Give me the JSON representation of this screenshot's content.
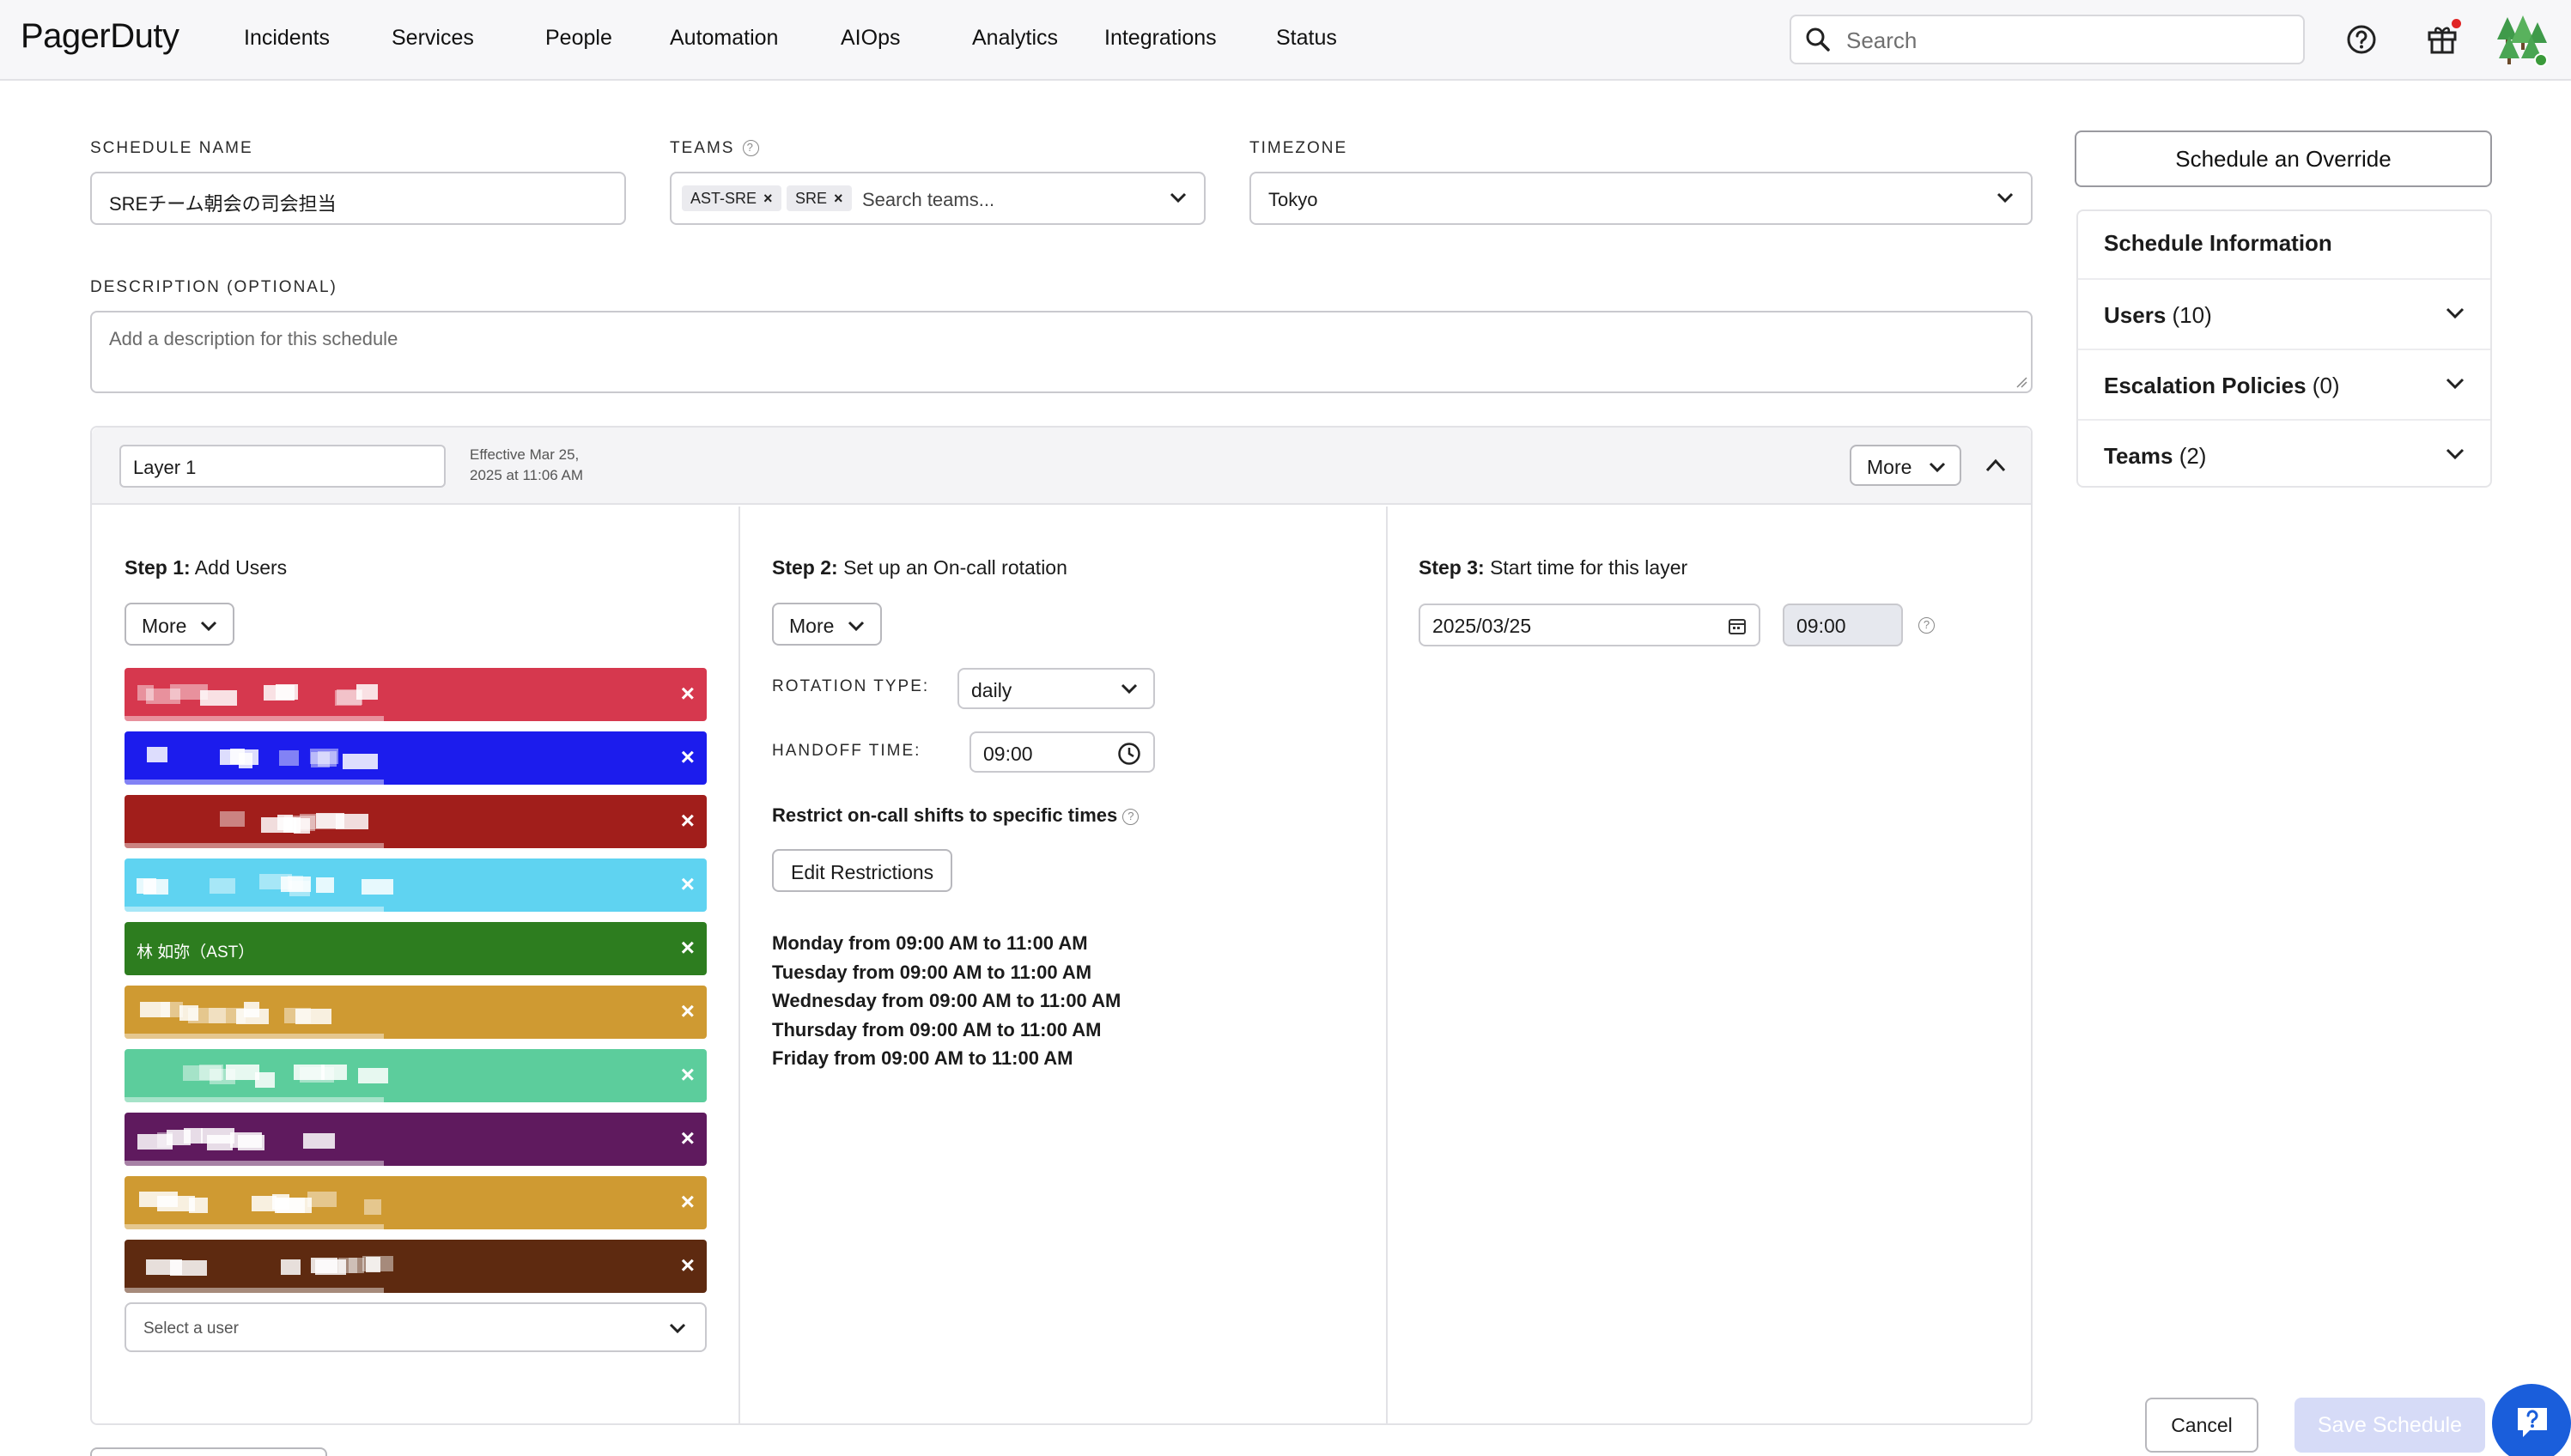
{
  "nav": {
    "logo": "PagerDuty",
    "items": [
      "Incidents",
      "Services",
      "People",
      "Automation",
      "AIOps",
      "Analytics",
      "Integrations",
      "Status"
    ],
    "search_placeholder": "Search"
  },
  "form": {
    "schedule_name_label": "SCHEDULE NAME",
    "schedule_name_value": "SREチーム朝会の司会担当",
    "teams_label": "TEAMS",
    "teams_chips": [
      "AST-SRE",
      "SRE"
    ],
    "teams_placeholder": "Search teams...",
    "timezone_label": "TIMEZONE",
    "timezone_value": "Tokyo",
    "description_label": "DESCRIPTION (OPTIONAL)",
    "description_placeholder": "Add a description for this schedule"
  },
  "layer": {
    "name": "Layer 1",
    "effective_line1": "Effective Mar 25,",
    "effective_line2": "2025 at 11:06 AM",
    "more_label": "More",
    "step1_bold": "Step 1:",
    "step1_text": " Add Users",
    "step1_more": "More",
    "users": [
      {
        "color": "#d6384e",
        "name": ""
      },
      {
        "color": "#1c1ced",
        "name": ""
      },
      {
        "color": "#a11e1b",
        "name": ""
      },
      {
        "color": "#5fd3f1",
        "name": ""
      },
      {
        "color": "#2d7d1f",
        "name": "林 如弥（AST）"
      },
      {
        "color": "#cf9a32",
        "name": ""
      },
      {
        "color": "#5ccd9c",
        "name": ""
      },
      {
        "color": "#5f1a5e",
        "name": ""
      },
      {
        "color": "#cf9a32",
        "name": ""
      },
      {
        "color": "#5e2a10",
        "name": ""
      }
    ],
    "select_user_placeholder": "Select a user",
    "step2_bold": "Step 2:",
    "step2_text": " Set up an On-call rotation",
    "step2_more": "More",
    "rotation_type_label": "ROTATION TYPE:",
    "rotation_type_value": "daily",
    "handoff_time_label": "HANDOFF TIME:",
    "handoff_time_value": "09:00",
    "restrict_label": "Restrict on-call shifts to specific times",
    "edit_restrictions": "Edit Restrictions",
    "restrictions": [
      "Monday from 09:00 AM to 11:00 AM",
      "Tuesday from 09:00 AM to 11:00 AM",
      "Wednesday from 09:00 AM to 11:00 AM",
      "Thursday from 09:00 AM to 11:00 AM",
      "Friday from 09:00 AM to 11:00 AM"
    ],
    "step3_bold": "Step 3:",
    "step3_text": " Start time for this layer",
    "start_date": "2025/03/25",
    "start_time": "09:00"
  },
  "sidebar": {
    "override_button": "Schedule an Override",
    "info_title": "Schedule Information",
    "rows": [
      {
        "label": "Users",
        "count": "(10)"
      },
      {
        "label": "Escalation Policies",
        "count": "(0)"
      },
      {
        "label": "Teams",
        "count": "(2)"
      }
    ]
  },
  "footer": {
    "cancel": "Cancel",
    "save": "Save Schedule"
  }
}
